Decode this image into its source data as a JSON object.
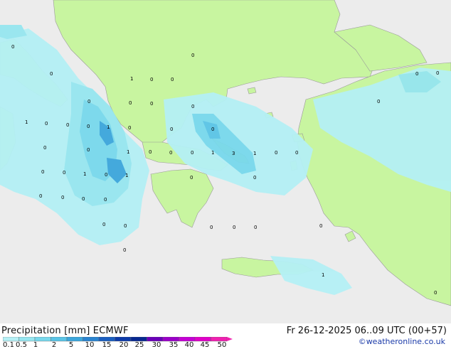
{
  "header": {
    "title": "Precipitation [mm] ECMWF",
    "valid_time": "Fr 26-12-2025 06..09 UTC (00+57)",
    "credit": "©weatheronline.co.uk"
  },
  "legend": {
    "ticks": [
      "0.1",
      "0.5",
      "1",
      "2",
      "5",
      "10",
      "15",
      "20",
      "25",
      "30",
      "35",
      "40",
      "45",
      "50"
    ],
    "colors": [
      "#b4f0f5",
      "#96e6f0",
      "#78d8ec",
      "#5ac4e6",
      "#3ca6dc",
      "#2a84d0",
      "#1a5ec0",
      "#0c3aa8",
      "#082890",
      "#6a00b8",
      "#9a00c8",
      "#c400d4",
      "#e000c8",
      "#f020b0"
    ]
  },
  "colors": {
    "sea": "#ececec",
    "land": "#c8f5a0",
    "border": "#9a9a9a"
  },
  "values": [
    {
      "text": "0"
    },
    {
      "text": "0"
    },
    {
      "text": "1"
    },
    {
      "text": "0"
    },
    {
      "text": "0"
    },
    {
      "text": "0"
    },
    {
      "text": "0"
    },
    {
      "text": "0"
    },
    {
      "text": "0"
    },
    {
      "text": "0"
    },
    {
      "text": "1"
    },
    {
      "text": "0"
    },
    {
      "text": "0"
    },
    {
      "text": "0"
    },
    {
      "text": "1"
    },
    {
      "text": "0"
    },
    {
      "text": "0"
    },
    {
      "text": "0"
    },
    {
      "text": "0"
    },
    {
      "text": "1"
    },
    {
      "text": "0"
    },
    {
      "text": "0"
    },
    {
      "text": "0"
    },
    {
      "text": "1"
    },
    {
      "text": "3"
    },
    {
      "text": "1"
    },
    {
      "text": "0"
    },
    {
      "text": "0"
    },
    {
      "text": "0"
    },
    {
      "text": "0"
    },
    {
      "text": "0"
    },
    {
      "text": "1"
    },
    {
      "text": "1"
    },
    {
      "text": "0"
    },
    {
      "text": "0"
    },
    {
      "text": "0"
    },
    {
      "text": "0"
    },
    {
      "text": "0"
    },
    {
      "text": "0"
    },
    {
      "text": "0"
    },
    {
      "text": "0"
    },
    {
      "text": "0"
    },
    {
      "text": "0"
    },
    {
      "text": "0"
    },
    {
      "text": "0"
    },
    {
      "text": "0"
    },
    {
      "text": "0"
    },
    {
      "text": "0"
    },
    {
      "text": "0"
    },
    {
      "text": "0"
    },
    {
      "text": "1"
    },
    {
      "text": "0"
    }
  ]
}
